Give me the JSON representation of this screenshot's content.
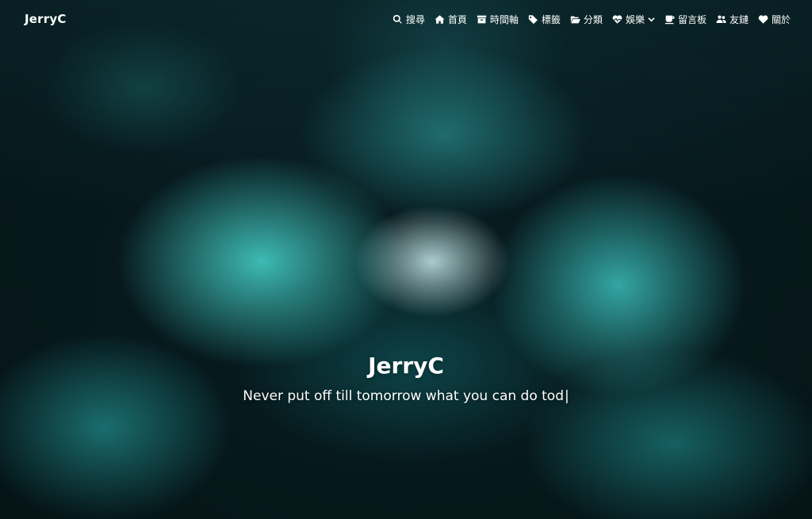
{
  "brand": {
    "label": "JerryC"
  },
  "nav": {
    "items": [
      {
        "label": "搜尋",
        "icon": "search-icon"
      },
      {
        "label": "首頁",
        "icon": "home-icon"
      },
      {
        "label": "時間軸",
        "icon": "archive-icon"
      },
      {
        "label": "標籤",
        "icon": "tags-icon"
      },
      {
        "label": "分類",
        "icon": "folder-open-icon"
      },
      {
        "label": "娛樂",
        "icon": "heartbeat-icon",
        "dropdown": true
      },
      {
        "label": "留言板",
        "icon": "coffee-icon"
      },
      {
        "label": "友鏈",
        "icon": "user-friends-icon"
      },
      {
        "label": "關於",
        "icon": "heart-icon"
      }
    ]
  },
  "site": {
    "title": "JerryC",
    "subtitle": "Never put off till tomorrow what you can do tod",
    "cursor": "|"
  },
  "colors": {
    "text": "#ffffff",
    "background_dark": "#071a1e",
    "smoke_accent": "#50f0e6"
  }
}
